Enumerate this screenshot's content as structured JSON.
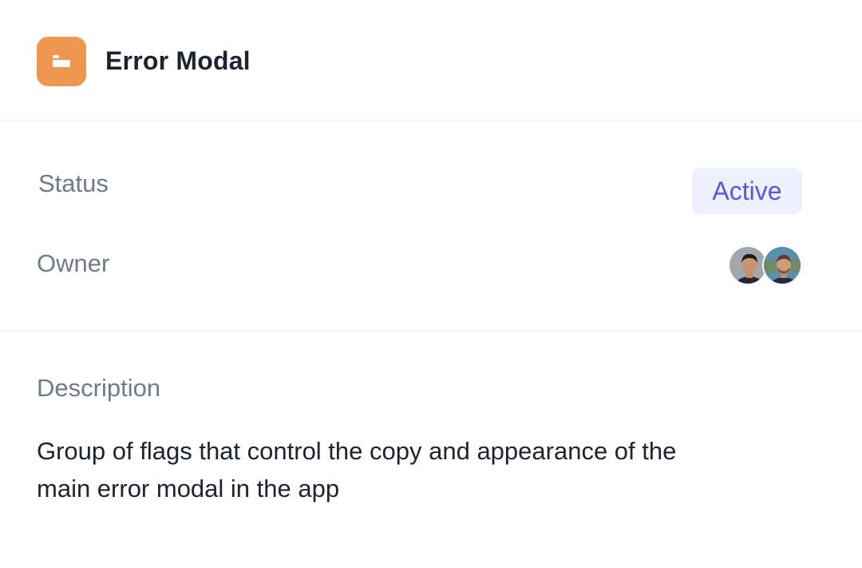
{
  "header": {
    "title": "Error Modal",
    "icon": "folder-icon",
    "icon_color": "#f0974f"
  },
  "meta": {
    "status_label": "Status",
    "status_value": "Active",
    "status_color": "#5558dd",
    "owner_label": "Owner",
    "owners": [
      {
        "name": "owner-avatar-1"
      },
      {
        "name": "owner-avatar-2"
      }
    ]
  },
  "description": {
    "label": "Description",
    "text": "Group of flags that control the copy and appearance of the main error modal in the app"
  }
}
